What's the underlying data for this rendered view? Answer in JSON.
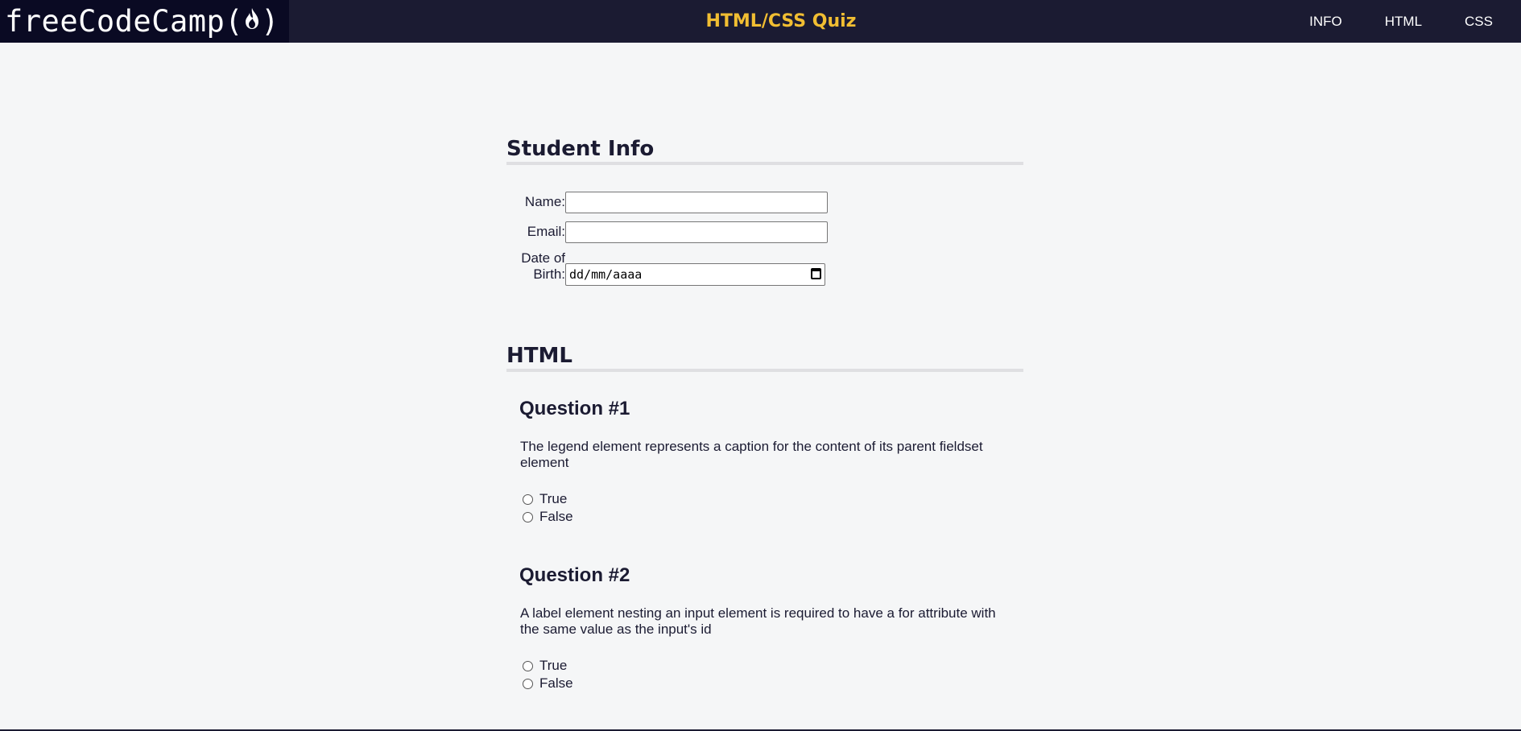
{
  "header": {
    "logo_text": "freeCodeCamp(",
    "logo_close": ")",
    "title": "HTML/CSS Quiz",
    "nav": [
      {
        "label": "INFO"
      },
      {
        "label": "HTML"
      },
      {
        "label": "CSS"
      }
    ]
  },
  "student_info": {
    "heading": "Student Info",
    "name_label": "Name:",
    "name_value": "",
    "email_label": "Email:",
    "email_value": "",
    "dob_label_line1": "Date of",
    "dob_label_line2": "Birth:",
    "dob_placeholder": "dd/mm/aaaa"
  },
  "html_section": {
    "heading": "HTML",
    "questions": [
      {
        "title": "Question #1",
        "text": "The legend element represents a caption for the content of its parent fieldset element",
        "options": [
          "True",
          "False"
        ]
      },
      {
        "title": "Question #2",
        "text": "A label element nesting an input element is required to have a for attribute with the same value as the input's id",
        "options": [
          "True",
          "False"
        ]
      }
    ]
  },
  "colors": {
    "header_bg": "#1b1b32",
    "logo_bg": "#0a0a23",
    "title_color": "#f1be32",
    "page_bg": "#f5f6f7"
  }
}
